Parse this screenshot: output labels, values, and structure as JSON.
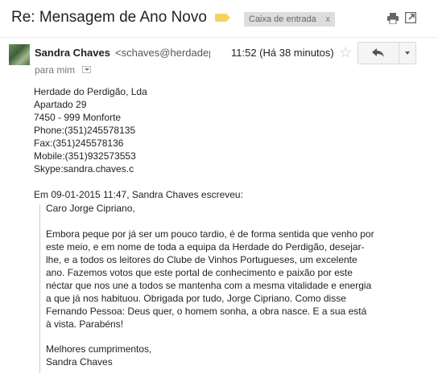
{
  "header": {
    "subject": "Re: Mensagem de Ano Novo",
    "label_color": "#f4d35e",
    "inbox_chip": "Caixa de entrada",
    "chip_close": "x",
    "icons": [
      "label-icon",
      "print-icon",
      "new-window-icon"
    ]
  },
  "message": {
    "sender_name": "Sandra Chaves",
    "sender_email": "<schaves@herdadep",
    "timestamp": "11:52 (Há 38 minutos)",
    "to_line": "para mim",
    "icons": [
      "star-icon",
      "reply-icon",
      "more-caret-icon",
      "to-details-caret-icon"
    ]
  },
  "signature": [
    "Herdade do Perdigão, Lda",
    "Apartado 29",
    "7450 - 999 Monforte",
    "Phone:(351)245578135",
    "Fax:(351)245578136",
    "Mobile:(351)932573553",
    "Skype:sandra.chaves.c"
  ],
  "quote_header": "Em 09-01-2015 11:47, Sandra Chaves escreveu:",
  "quote": {
    "greeting": "Caro Jorge Cipriano,",
    "paragraph": [
      "Embora peque por já ser um pouco tardio, é de forma sentida que venho por",
      "este meio, e em nome de toda a equipa da Herdade do Perdigão, desejar-",
      "lhe, e a todos os leitores do Clube de Vinhos Portugueses, um excelente",
      "ano. Fazemos votos que este portal de conhecimento e paixão por este",
      "néctar que nos une a todos se mantenha com a mesma vitalidade e energia",
      "a que já nos habituou. Obrigada por tudo, Jorge Cipriano. Como disse",
      "Fernando Pessoa: Deus quer, o homem sonha, a obra nasce. E a sua está",
      "à vista. Parabéns!"
    ],
    "closing": "Melhores cumprimentos,",
    "closing_name": "Sandra Chaves"
  }
}
